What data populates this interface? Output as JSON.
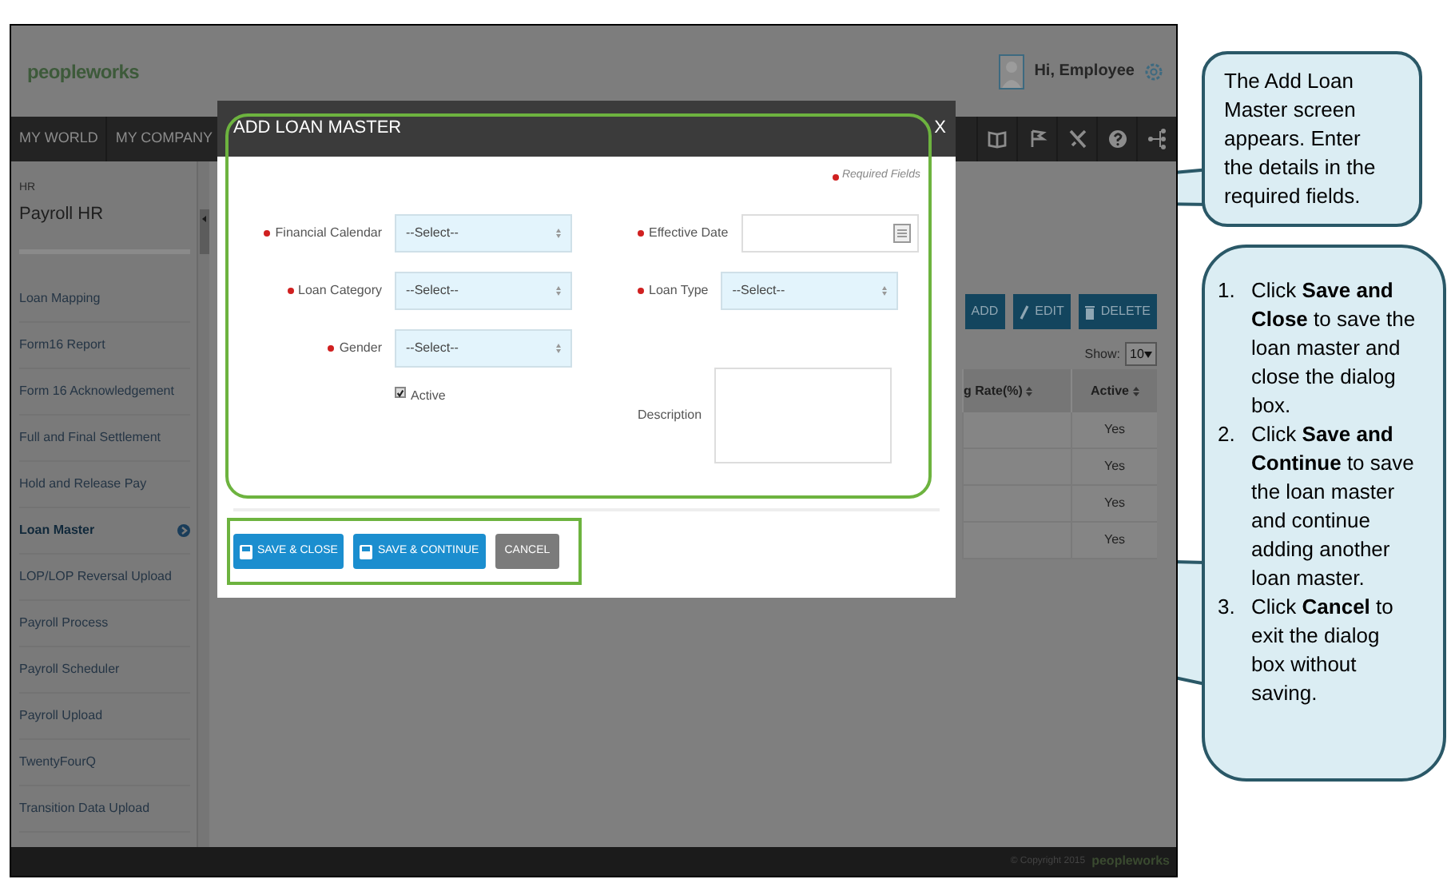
{
  "app": {
    "logo": "peopleworks",
    "user_greeting": "Hi, Employee",
    "nav": [
      {
        "label": "MY WORLD"
      },
      {
        "label": "MY COMPANY"
      }
    ],
    "sidebar": {
      "section": "HR",
      "title": "Payroll HR",
      "items": [
        {
          "label": "Loan Mapping",
          "selected": false
        },
        {
          "label": "Form16 Report",
          "selected": false
        },
        {
          "label": "Form 16 Acknowledgement",
          "selected": false
        },
        {
          "label": "Full and Final Settlement",
          "selected": false
        },
        {
          "label": "Hold and Release Pay",
          "selected": false
        },
        {
          "label": "Loan Master",
          "selected": true
        },
        {
          "label": "LOP/LOP Reversal Upload",
          "selected": false
        },
        {
          "label": "Payroll Process",
          "selected": false
        },
        {
          "label": "Payroll Scheduler",
          "selected": false
        },
        {
          "label": "Payroll Upload",
          "selected": false
        },
        {
          "label": "TwentyFourQ",
          "selected": false
        },
        {
          "label": "Transition Data Upload",
          "selected": false
        }
      ]
    },
    "toolbar": [
      {
        "label": "ADD",
        "kind": "add"
      },
      {
        "label": "EDIT",
        "kind": "edit"
      },
      {
        "label": "DELETE",
        "kind": "delete"
      }
    ],
    "show_label": "Show:",
    "page_size": "10",
    "table": {
      "columns": [
        "g Rate(%)",
        "Active"
      ],
      "rows": [
        [
          "",
          "Yes"
        ],
        [
          "",
          "Yes"
        ],
        [
          "",
          "Yes"
        ],
        [
          "",
          "Yes"
        ]
      ]
    },
    "footer": {
      "copyright": "© Copyright 2015",
      "logo": "peopleworks"
    }
  },
  "dialog": {
    "title": "ADD LOAN MASTER",
    "close": "X",
    "required_note": "Required Fields",
    "fields_left": [
      {
        "kind": "select",
        "label": "Financial Calendar",
        "required": true,
        "value": "--Select--"
      },
      {
        "kind": "select",
        "label": "Loan Category",
        "required": true,
        "value": "--Select--"
      },
      {
        "kind": "select",
        "label": "Gender",
        "required": true,
        "value": "--Select--"
      },
      {
        "kind": "checkbox",
        "label": "Active",
        "checked": true
      }
    ],
    "fields_right": [
      {
        "kind": "date",
        "label": "Effective Date",
        "required": true
      },
      {
        "kind": "select",
        "label": "Loan Type",
        "required": true,
        "value": "--Select--"
      },
      {
        "kind": "textarea",
        "label": "Description",
        "required": false
      }
    ],
    "buttons": [
      {
        "label": "SAVE & CLOSE",
        "kind": "primary"
      },
      {
        "label": "SAVE & CONTINUE",
        "kind": "primary"
      },
      {
        "label": "CANCEL",
        "kind": "secondary"
      }
    ]
  },
  "callouts": [
    {
      "text": "The Add Loan Master screen appears. Enter the details in the required fields."
    },
    {
      "steps": [
        {
          "marker": "1.",
          "text": "Click **Save and Close** to save the loan master and close the dialog box."
        },
        {
          "marker": "2.",
          "text": "Click **Save and Continue** to save the loan master and continue adding another loan master."
        },
        {
          "marker": "3.",
          "text": "Click **Cancel** to exit the dialog box without saving."
        }
      ]
    }
  ]
}
